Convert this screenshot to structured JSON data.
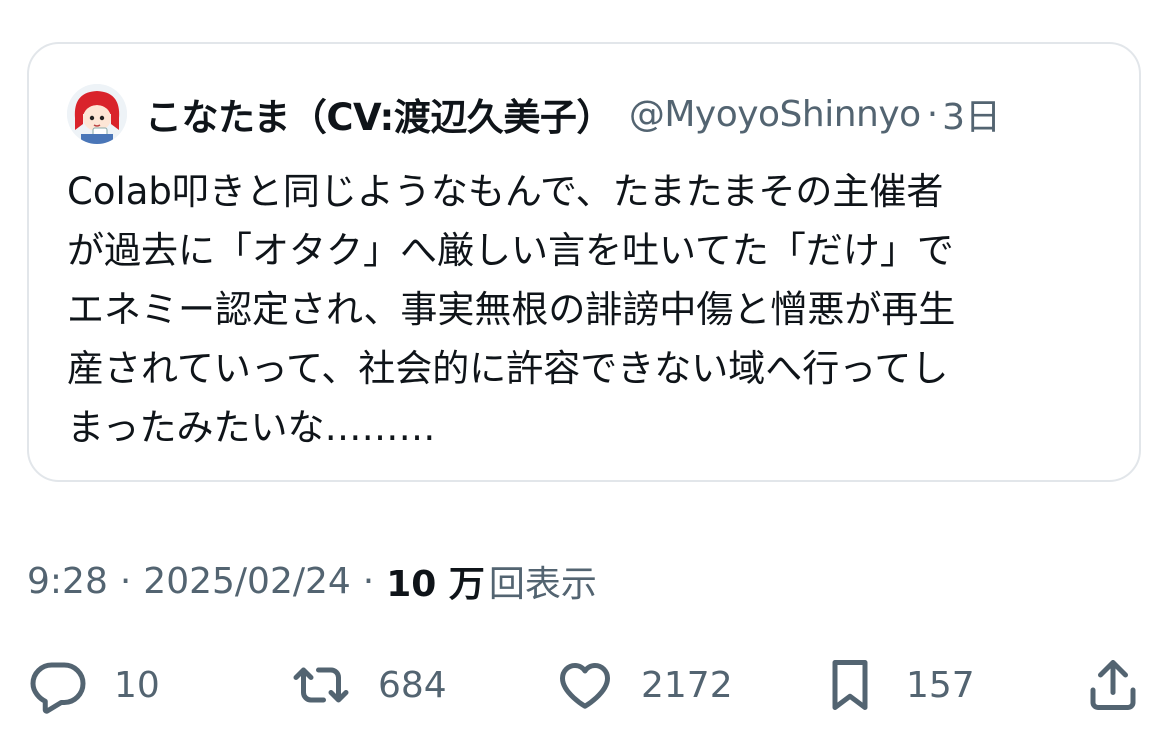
{
  "quoted_post": {
    "author_name": "こなたま（CV:渡辺久美子）",
    "author_handle": "@MyoyoShinnyo",
    "separator": "·",
    "age": "3日",
    "text": "Colab叩きと同じようなもんで、たまたまその主催者\nが過去に「オタク」へ厳しい言を吐いてた「だけ」で\nエネミー認定され、事実無根の誹謗中傷と憎悪が再生\n産されていって、社会的に許容できない域へ行ってし\nまったみたいな………"
  },
  "post_meta": {
    "time": "9:28",
    "separator": "·",
    "date": "2025/02/24",
    "views_count": "10 万",
    "views_label": "回表示"
  },
  "actions": {
    "reply": {
      "icon": "reply-icon",
      "count": "10"
    },
    "repost": {
      "icon": "repost-icon",
      "count": "684"
    },
    "like": {
      "icon": "heart-icon",
      "count": "2172"
    },
    "bookmark": {
      "icon": "bookmark-icon",
      "count": "157"
    },
    "share": {
      "icon": "share-icon"
    }
  },
  "colors": {
    "text_primary": "#0f1419",
    "text_secondary": "#536471",
    "card_border": "#e2e6ea",
    "avatar_hair": "#d9232b"
  }
}
